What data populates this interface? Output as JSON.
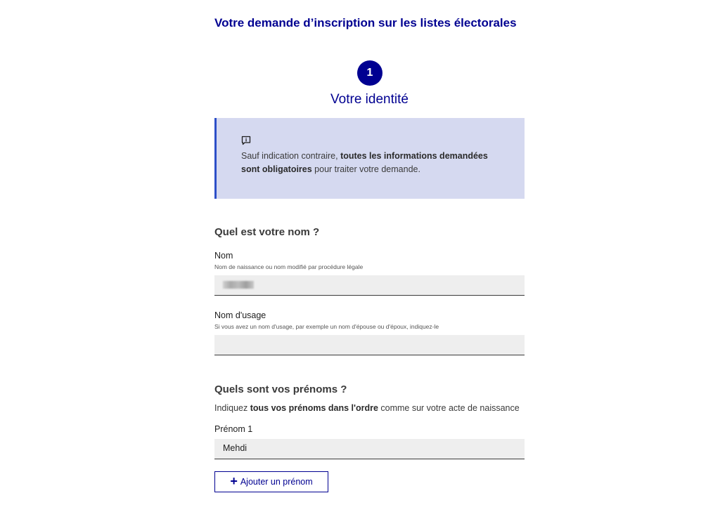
{
  "form": {
    "title": "Votre demande d’inscription sur les listes électorales"
  },
  "step": {
    "number": "1",
    "title": "Votre identité"
  },
  "info": {
    "icon": "info-icon",
    "text_before": "Sauf indication contraire, ",
    "text_bold": "toutes les informations demandées sont obligatoires",
    "text_after": " pour traiter votre demande."
  },
  "colors": {
    "primary": "#000091",
    "info_background": "#d5d9f0",
    "info_border": "#2d4fc8",
    "input_background": "#eeeeee"
  },
  "name_section": {
    "title": "Quel est votre nom ?",
    "nom": {
      "label": "Nom",
      "hint": "Nom de naissance ou nom modifié par procédure légale",
      "value": ""
    },
    "nom_usage": {
      "label": "Nom d'usage",
      "hint": "Si vous avez un nom d'usage, par exemple un nom d'épouse ou d'époux, indiquez-le",
      "value": ""
    }
  },
  "prenoms_section": {
    "title": "Quels sont vos prénoms ?",
    "intro_before": "Indiquez ",
    "intro_bold": "tous vos prénoms dans l'ordre",
    "intro_after": " comme sur votre acte de naissance",
    "prenom1": {
      "label": "Prénom 1",
      "value": "Mehdi"
    },
    "add_button": {
      "icon": "plus-icon",
      "label": "Ajouter un prénom"
    }
  }
}
